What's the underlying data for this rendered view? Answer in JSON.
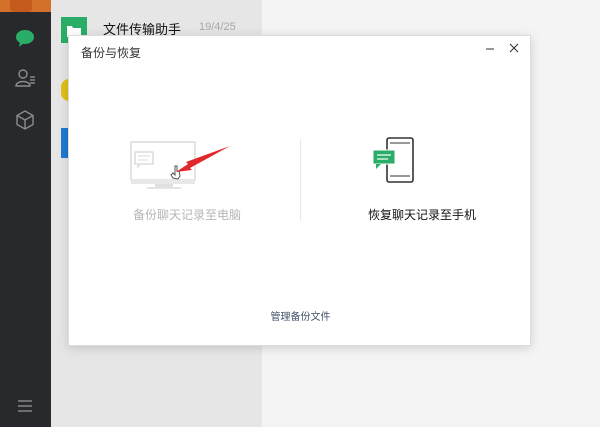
{
  "sidebar": {
    "icons": [
      "chat-icon",
      "contacts-icon",
      "box-icon",
      "menu-icon"
    ]
  },
  "chat_list": {
    "items": [
      {
        "name": "文件传输助手",
        "time": "19/4/25"
      }
    ]
  },
  "dialog": {
    "title": "备份与恢复",
    "minimize_label": "−",
    "close_label": "×",
    "backup_option": {
      "label": "备份聊天记录至电脑"
    },
    "restore_option": {
      "label": "恢复聊天记录至手机"
    },
    "manage_link": "管理备份文件"
  },
  "colors": {
    "sidebar_bg": "#27292c",
    "brand_green": "#2aae67",
    "annotation_red": "#e0282c",
    "disabled_text": "#b6b6b6",
    "link_text": "#43546b"
  }
}
